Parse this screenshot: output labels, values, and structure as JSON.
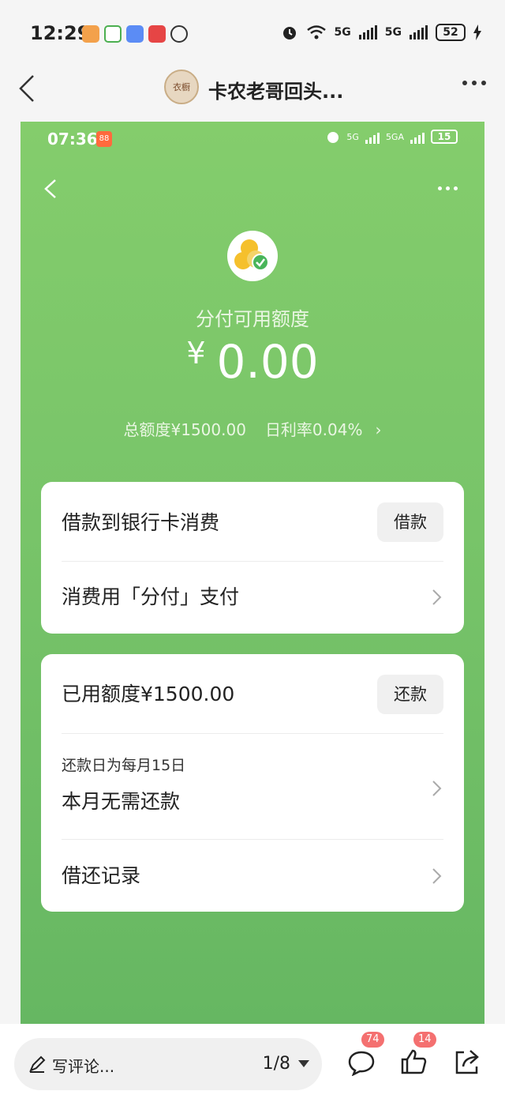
{
  "status_bar": {
    "time": "12:29",
    "network_1": "5G",
    "network_2": "5G",
    "battery": "52"
  },
  "post": {
    "title": "卡农老哥回头...",
    "avatar_text": "衣橱"
  },
  "inner_status": {
    "time": "07:36",
    "battery": "15",
    "net1": "5G",
    "net2": "5GA"
  },
  "credit": {
    "title": "分付可用额度",
    "currency": "¥",
    "amount": "0.00",
    "total_limit": "总额度¥1500.00",
    "daily_rate": "日利率0.04%"
  },
  "card1": {
    "borrow_label": "借款到银行卡消费",
    "borrow_button": "借款",
    "pay_label": "消费用「分付」支付"
  },
  "card2": {
    "used_label": "已用额度¥1500.00",
    "repay_button": "还款",
    "due_label": "还款日为每月15日",
    "due_status": "本月无需还款",
    "records_label": "借还记录"
  },
  "bottom_bar": {
    "comment_placeholder": "写评论...",
    "page_indicator": "1/8",
    "comment_count": "74",
    "like_count": "14"
  },
  "colors": {
    "green_top": "#84cd6c",
    "green_bottom": "#66b762",
    "badge": "#f47070"
  }
}
